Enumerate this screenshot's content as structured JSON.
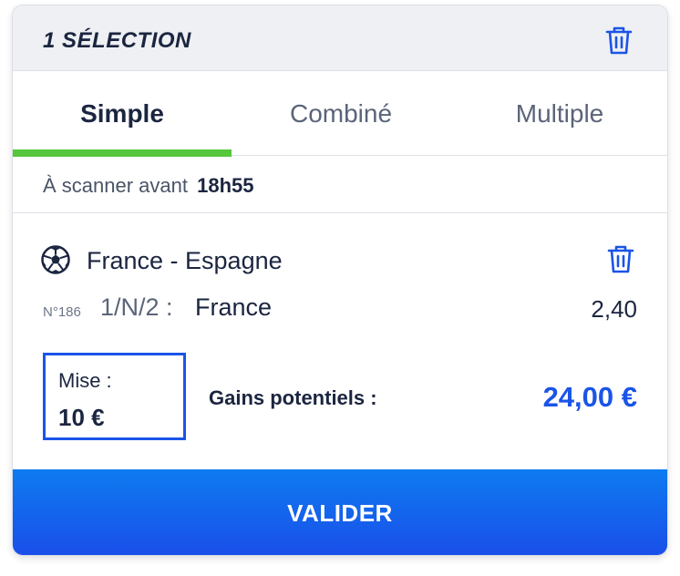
{
  "header": {
    "title": "1 SÉLECTION"
  },
  "tabs": [
    {
      "label": "Simple",
      "active": true
    },
    {
      "label": "Combiné",
      "active": false
    },
    {
      "label": "Multiple",
      "active": false
    }
  ],
  "scan": {
    "label": "À scanner avant",
    "time": "18h55"
  },
  "bet": {
    "sport_icon": "soccer-ball-icon",
    "match": "France - Espagne",
    "number": "N°186",
    "market": "1/N/2 :",
    "selection": "France",
    "odds": "2,40"
  },
  "stake": {
    "label": "Mise :",
    "value": "10 €"
  },
  "gains": {
    "label": "Gains potentiels :",
    "value": "24,00 €"
  },
  "submit": {
    "label": "VALIDER"
  },
  "colors": {
    "accent_blue": "#1a54e8",
    "tab_indicator_green": "#56c63c",
    "header_bg": "#eef0f3",
    "text_dark": "#1b2540"
  }
}
